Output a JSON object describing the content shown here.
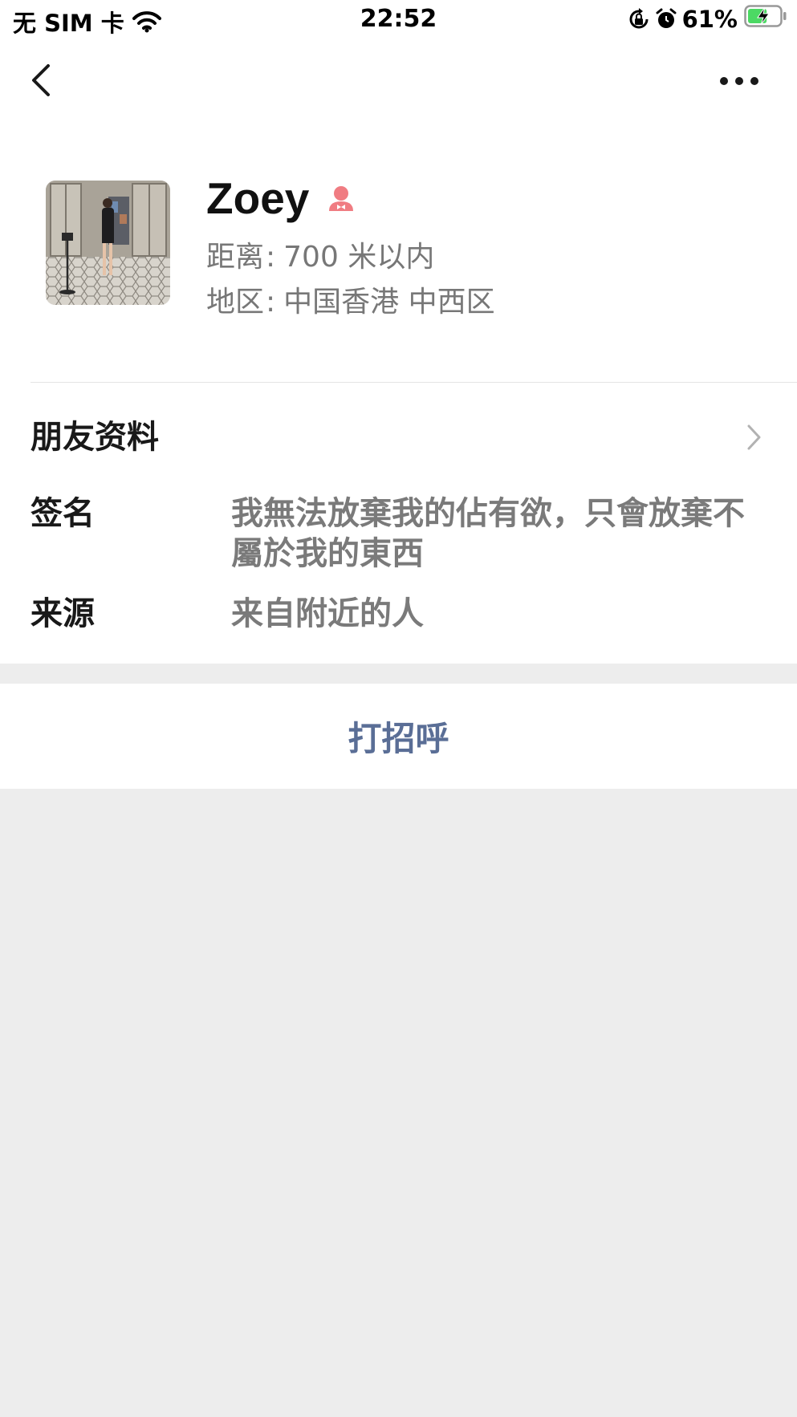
{
  "status_bar": {
    "carrier": "无 SIM 卡",
    "time": "22:52",
    "battery_percent": "61%",
    "battery_level": 0.61
  },
  "nav": {
    "back_icon": "chevron-left-icon",
    "more_icon": "more-dots-icon"
  },
  "profile": {
    "name": "Zoey",
    "gender_icon": "female-icon",
    "gender_color": "#f07c82",
    "distance_label": "距离",
    "distance_value": "700 米以内",
    "region_label": "地区",
    "region_value": "中国香港 中西区"
  },
  "details": {
    "section_title": "朋友资料",
    "signature_label": "签名",
    "signature_value": "我無法放棄我的佔有欲，只會放棄不屬於我的東西",
    "source_label": "来源",
    "source_value": "来自附近的人"
  },
  "action": {
    "greet_label": "打招呼",
    "color": "#5a6e96"
  }
}
